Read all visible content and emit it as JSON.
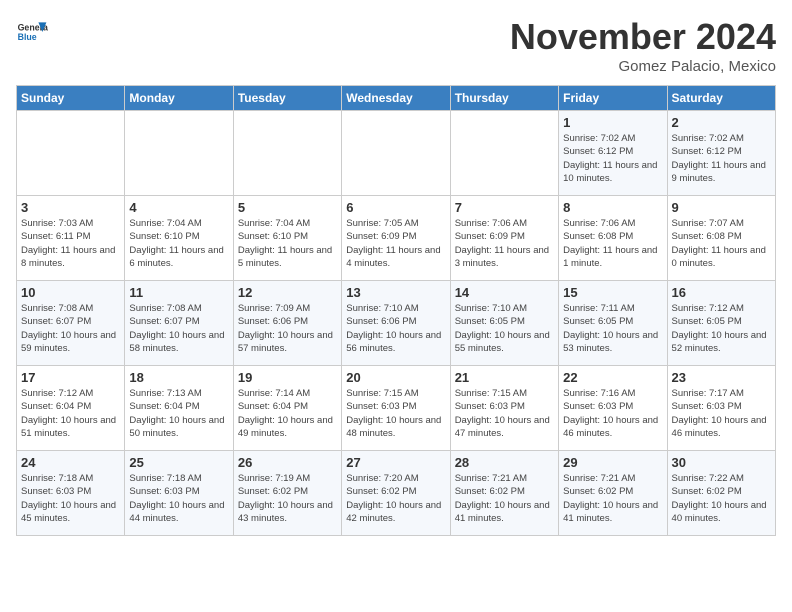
{
  "header": {
    "logo_general": "General",
    "logo_blue": "Blue",
    "month": "November 2024",
    "location": "Gomez Palacio, Mexico"
  },
  "weekdays": [
    "Sunday",
    "Monday",
    "Tuesday",
    "Wednesday",
    "Thursday",
    "Friday",
    "Saturday"
  ],
  "weeks": [
    [
      {
        "day": "",
        "detail": ""
      },
      {
        "day": "",
        "detail": ""
      },
      {
        "day": "",
        "detail": ""
      },
      {
        "day": "",
        "detail": ""
      },
      {
        "day": "",
        "detail": ""
      },
      {
        "day": "1",
        "detail": "Sunrise: 7:02 AM\nSunset: 6:12 PM\nDaylight: 11 hours and 10 minutes."
      },
      {
        "day": "2",
        "detail": "Sunrise: 7:02 AM\nSunset: 6:12 PM\nDaylight: 11 hours and 9 minutes."
      }
    ],
    [
      {
        "day": "3",
        "detail": "Sunrise: 7:03 AM\nSunset: 6:11 PM\nDaylight: 11 hours and 8 minutes."
      },
      {
        "day": "4",
        "detail": "Sunrise: 7:04 AM\nSunset: 6:10 PM\nDaylight: 11 hours and 6 minutes."
      },
      {
        "day": "5",
        "detail": "Sunrise: 7:04 AM\nSunset: 6:10 PM\nDaylight: 11 hours and 5 minutes."
      },
      {
        "day": "6",
        "detail": "Sunrise: 7:05 AM\nSunset: 6:09 PM\nDaylight: 11 hours and 4 minutes."
      },
      {
        "day": "7",
        "detail": "Sunrise: 7:06 AM\nSunset: 6:09 PM\nDaylight: 11 hours and 3 minutes."
      },
      {
        "day": "8",
        "detail": "Sunrise: 7:06 AM\nSunset: 6:08 PM\nDaylight: 11 hours and 1 minute."
      },
      {
        "day": "9",
        "detail": "Sunrise: 7:07 AM\nSunset: 6:08 PM\nDaylight: 11 hours and 0 minutes."
      }
    ],
    [
      {
        "day": "10",
        "detail": "Sunrise: 7:08 AM\nSunset: 6:07 PM\nDaylight: 10 hours and 59 minutes."
      },
      {
        "day": "11",
        "detail": "Sunrise: 7:08 AM\nSunset: 6:07 PM\nDaylight: 10 hours and 58 minutes."
      },
      {
        "day": "12",
        "detail": "Sunrise: 7:09 AM\nSunset: 6:06 PM\nDaylight: 10 hours and 57 minutes."
      },
      {
        "day": "13",
        "detail": "Sunrise: 7:10 AM\nSunset: 6:06 PM\nDaylight: 10 hours and 56 minutes."
      },
      {
        "day": "14",
        "detail": "Sunrise: 7:10 AM\nSunset: 6:05 PM\nDaylight: 10 hours and 55 minutes."
      },
      {
        "day": "15",
        "detail": "Sunrise: 7:11 AM\nSunset: 6:05 PM\nDaylight: 10 hours and 53 minutes."
      },
      {
        "day": "16",
        "detail": "Sunrise: 7:12 AM\nSunset: 6:05 PM\nDaylight: 10 hours and 52 minutes."
      }
    ],
    [
      {
        "day": "17",
        "detail": "Sunrise: 7:12 AM\nSunset: 6:04 PM\nDaylight: 10 hours and 51 minutes."
      },
      {
        "day": "18",
        "detail": "Sunrise: 7:13 AM\nSunset: 6:04 PM\nDaylight: 10 hours and 50 minutes."
      },
      {
        "day": "19",
        "detail": "Sunrise: 7:14 AM\nSunset: 6:04 PM\nDaylight: 10 hours and 49 minutes."
      },
      {
        "day": "20",
        "detail": "Sunrise: 7:15 AM\nSunset: 6:03 PM\nDaylight: 10 hours and 48 minutes."
      },
      {
        "day": "21",
        "detail": "Sunrise: 7:15 AM\nSunset: 6:03 PM\nDaylight: 10 hours and 47 minutes."
      },
      {
        "day": "22",
        "detail": "Sunrise: 7:16 AM\nSunset: 6:03 PM\nDaylight: 10 hours and 46 minutes."
      },
      {
        "day": "23",
        "detail": "Sunrise: 7:17 AM\nSunset: 6:03 PM\nDaylight: 10 hours and 46 minutes."
      }
    ],
    [
      {
        "day": "24",
        "detail": "Sunrise: 7:18 AM\nSunset: 6:03 PM\nDaylight: 10 hours and 45 minutes."
      },
      {
        "day": "25",
        "detail": "Sunrise: 7:18 AM\nSunset: 6:03 PM\nDaylight: 10 hours and 44 minutes."
      },
      {
        "day": "26",
        "detail": "Sunrise: 7:19 AM\nSunset: 6:02 PM\nDaylight: 10 hours and 43 minutes."
      },
      {
        "day": "27",
        "detail": "Sunrise: 7:20 AM\nSunset: 6:02 PM\nDaylight: 10 hours and 42 minutes."
      },
      {
        "day": "28",
        "detail": "Sunrise: 7:21 AM\nSunset: 6:02 PM\nDaylight: 10 hours and 41 minutes."
      },
      {
        "day": "29",
        "detail": "Sunrise: 7:21 AM\nSunset: 6:02 PM\nDaylight: 10 hours and 41 minutes."
      },
      {
        "day": "30",
        "detail": "Sunrise: 7:22 AM\nSunset: 6:02 PM\nDaylight: 10 hours and 40 minutes."
      }
    ]
  ]
}
